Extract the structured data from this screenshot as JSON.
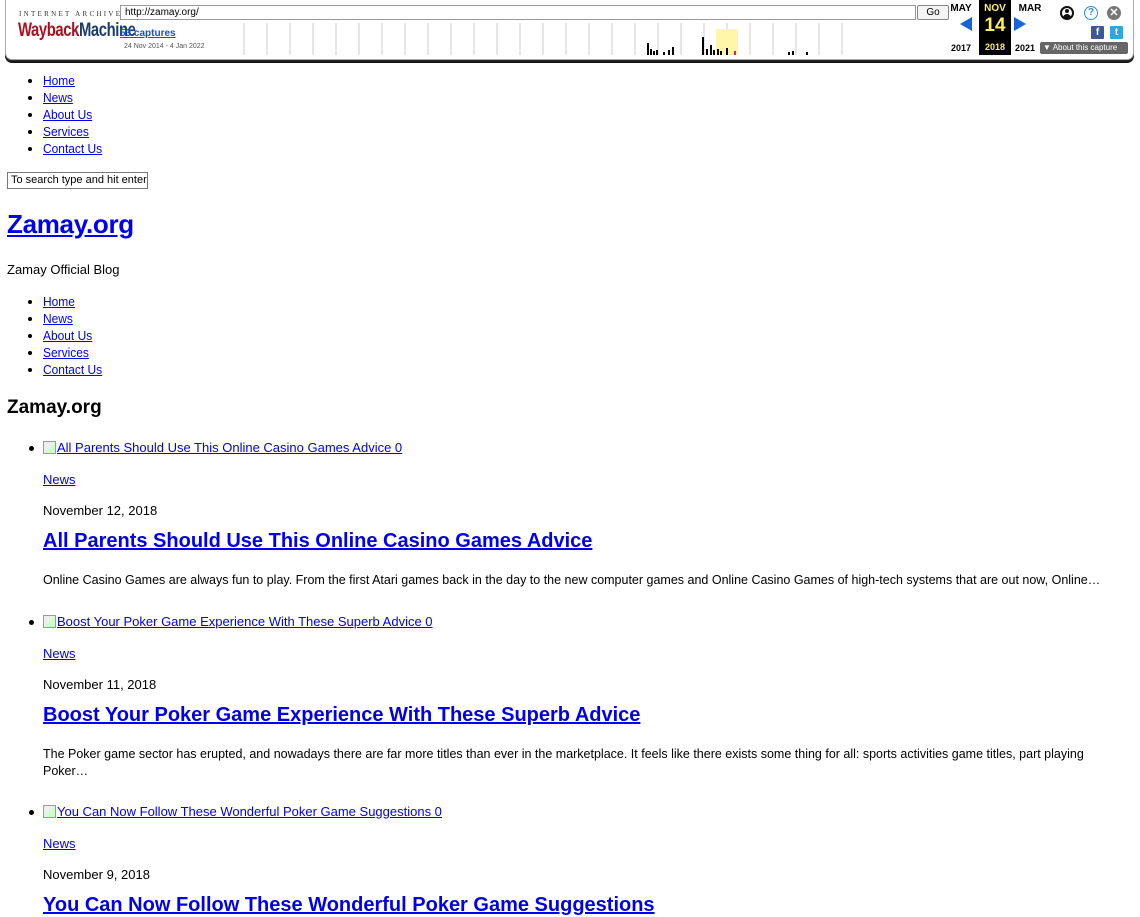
{
  "wayback": {
    "logo_top": "INTERNET ARCHIVE",
    "logo_main_a": "Wayback",
    "logo_main_b": "Machine",
    "url": "http://zamay.org/",
    "go_label": "Go",
    "captures_label": "53 captures",
    "range_label": "24 Nov 2014 - 4 Jan 2022",
    "prev_month": "MAY",
    "current_month": "NOV",
    "next_month": "MAR",
    "prev_year": "2017",
    "current_day": "14",
    "current_year": "2018",
    "next_year": "2021",
    "about_label": "▼ About this capture",
    "facebook_icon": "f",
    "twitter_icon": "t",
    "help_icon": "?",
    "close_icon": "✕"
  },
  "nav_top": [
    "Home",
    "News",
    "About Us",
    "Services",
    "Contact Us"
  ],
  "search_placeholder": "To search type and hit enter",
  "site_title": "Zamay.org",
  "site_tagline": "Zamay Official Blog",
  "nav_bottom": [
    "Home",
    "News",
    "About Us",
    "Services",
    "Contact Us"
  ],
  "section_title": "Zamay.org",
  "posts": [
    {
      "image_alt": "All Parents Should Use This Online Casino Games Advice 0",
      "category": "News",
      "date": "November 12, 2018",
      "title": "All Parents Should Use This Online Casino Games Advice",
      "excerpt": "Online Casino Games are always fun to play. From the first Atari games back in the day to the new computer games and Online Casino Games of high-tech systems that are out now, Online…"
    },
    {
      "image_alt": "Boost Your Poker Game Experience With These Superb Advice 0",
      "category": "News",
      "date": "November 11, 2018",
      "title": "Boost Your Poker Game Experience With These Superb Advice",
      "excerpt": "The Poker game sector has erupted, and nowadays there are far more titles than ever in the marketplace. It feels like there exists some thing for all: sports activities game titles, part playing Poker…"
    },
    {
      "image_alt": "You Can Now Follow These Wonderful Poker Game Suggestions 0",
      "category": "News",
      "date": "November 9, 2018",
      "title": "You Can Now Follow These Wonderful Poker Game Suggestions",
      "excerpt": ""
    }
  ]
}
